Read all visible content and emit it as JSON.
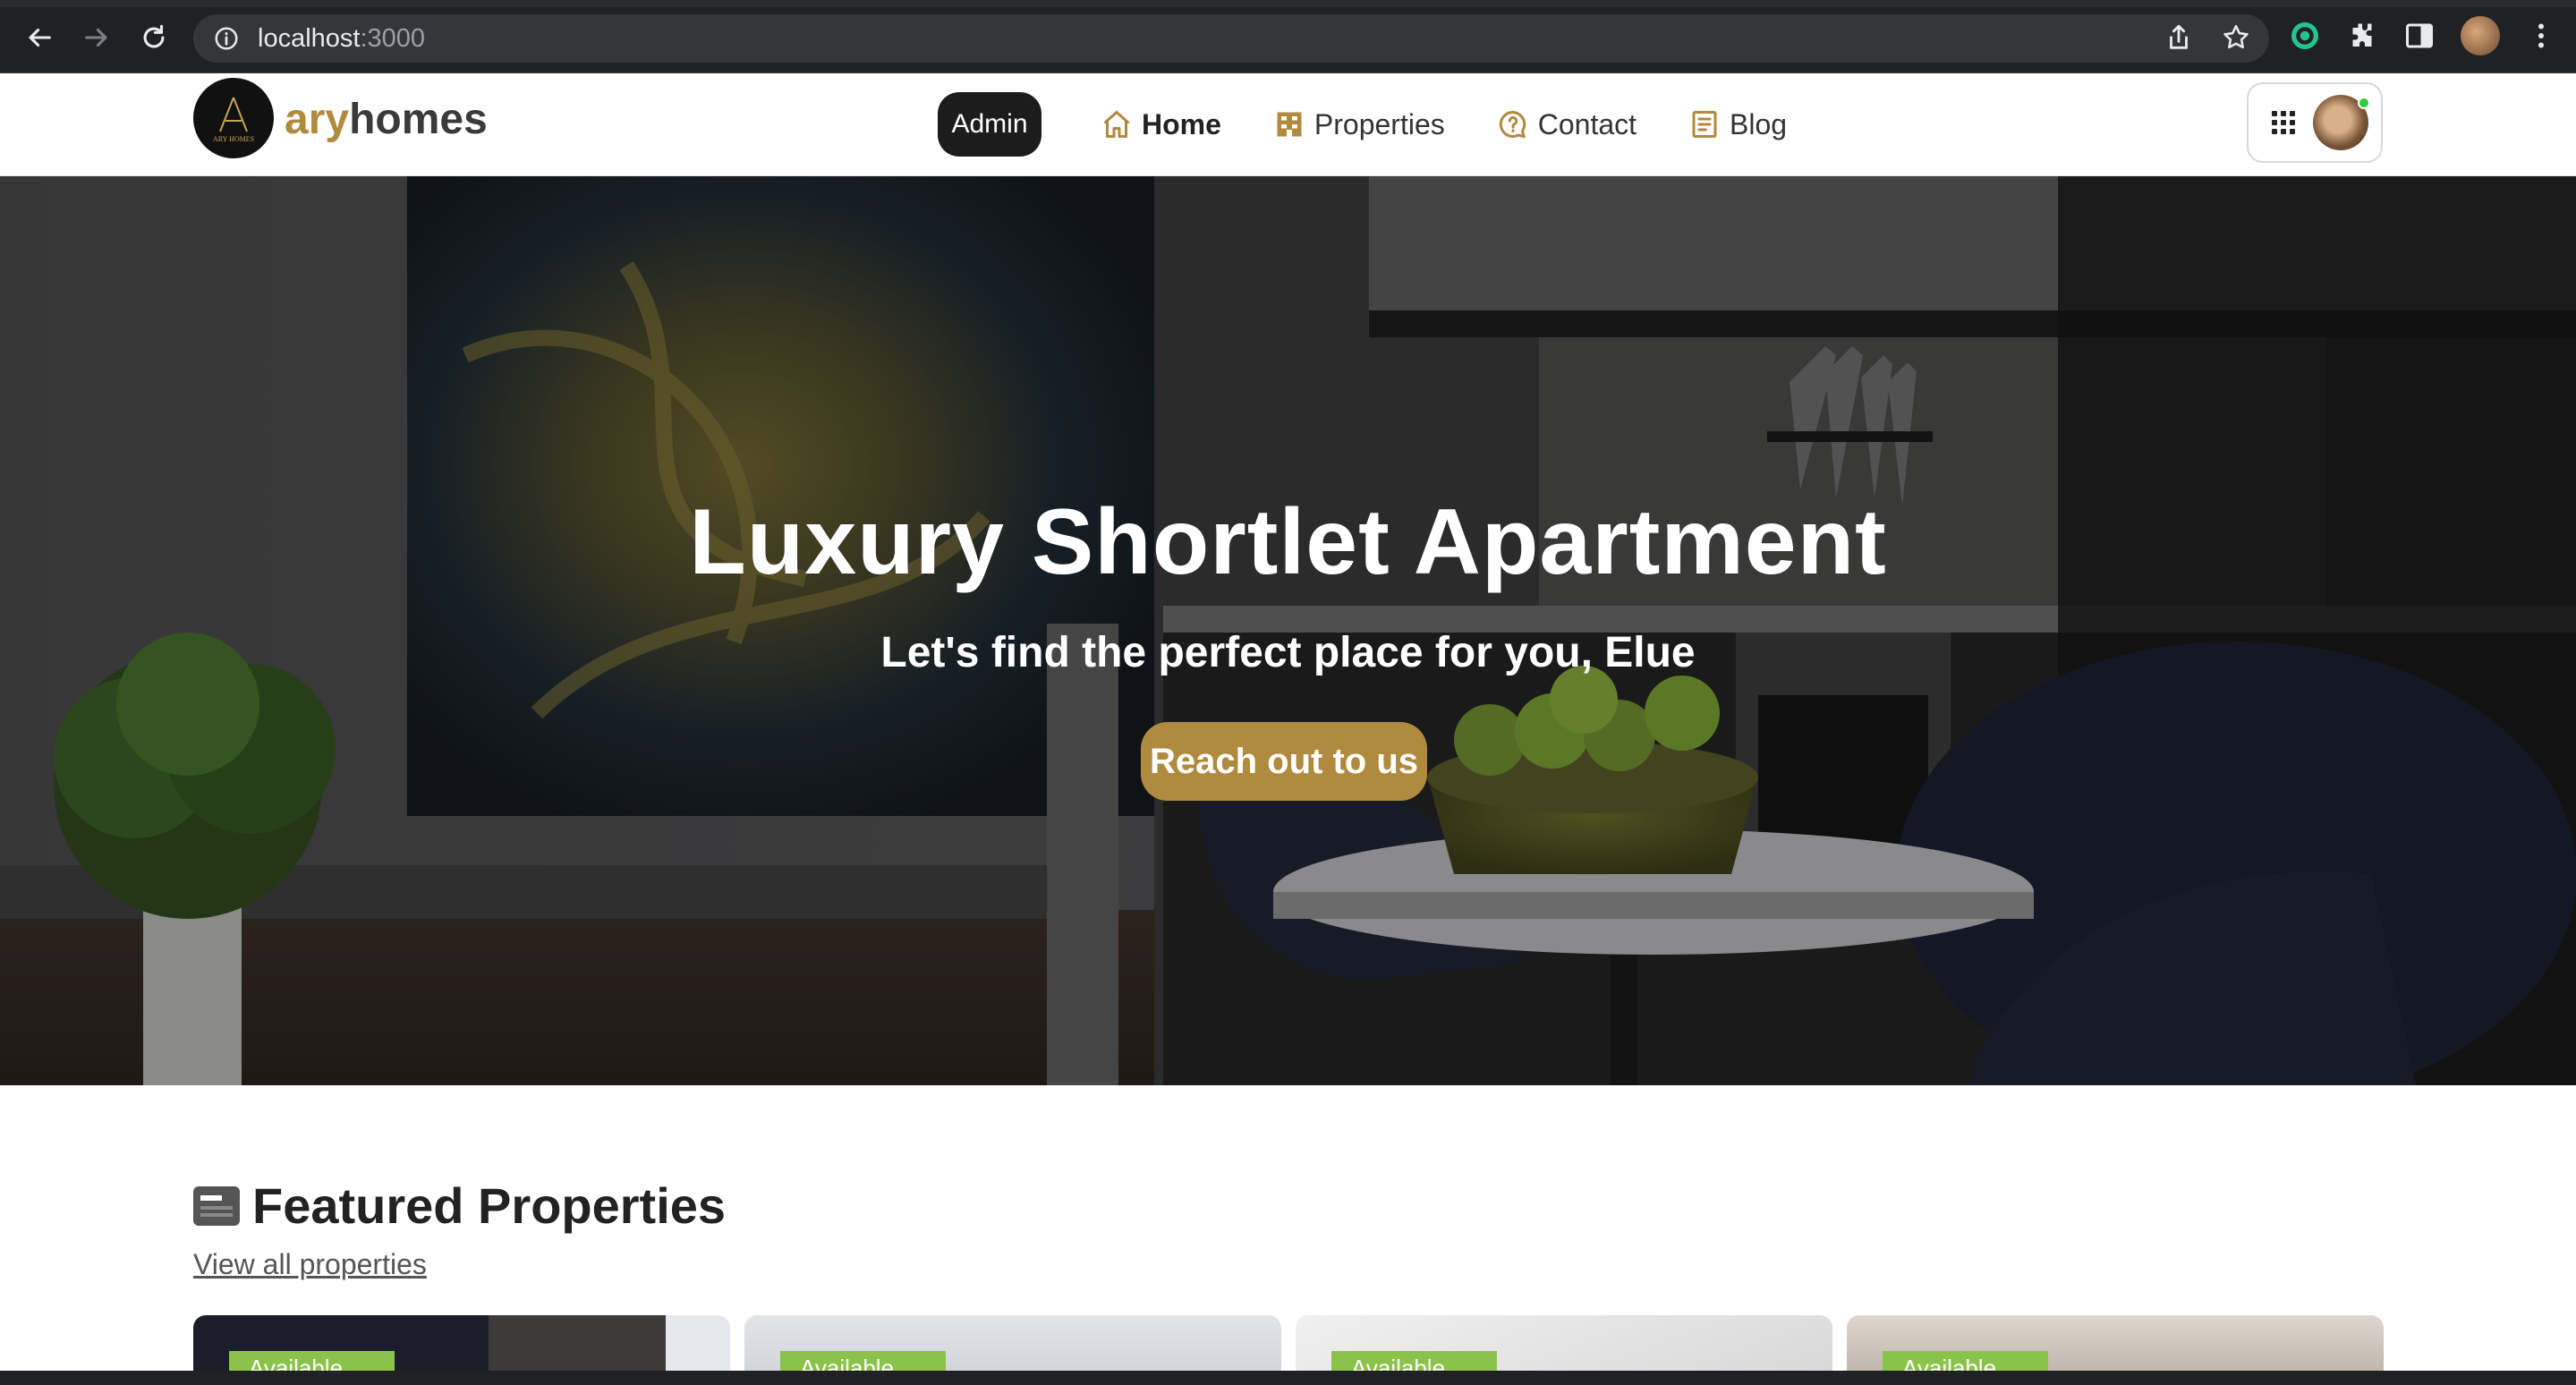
{
  "browser": {
    "url_host": "localhost",
    "url_port": ":3000"
  },
  "header": {
    "brand_part1": "ary",
    "brand_part2": "homes",
    "logo_text": "ARY HOMES",
    "nav": {
      "admin": "Admin",
      "home": "Home",
      "properties": "Properties",
      "contact": "Contact",
      "blog": "Blog"
    }
  },
  "hero": {
    "title": "Luxury Shortlet Apartment",
    "subtitle": "Let's find the perfect place for you, Elue",
    "cta": "Reach out to us"
  },
  "featured": {
    "title": "Featured Properties",
    "view_all": "View all properties",
    "cards": [
      {
        "badge": "Available"
      },
      {
        "badge": "Available"
      },
      {
        "badge": "Available"
      },
      {
        "badge": "Available"
      }
    ]
  },
  "colors": {
    "brand_gold": "#b08a3e",
    "admin_bg": "#1c1c1c",
    "available_green": "#8bc34a"
  }
}
